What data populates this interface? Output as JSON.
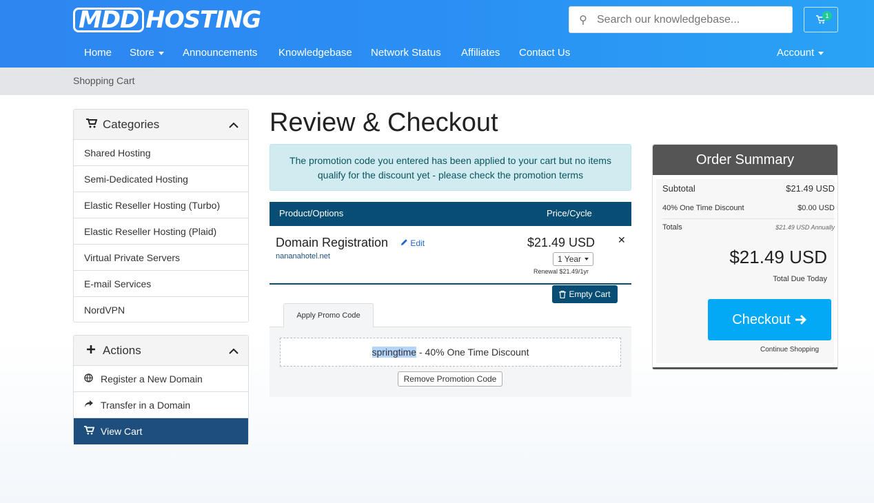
{
  "header": {
    "logo_a": "MDD",
    "logo_b": "HOSTING",
    "search_placeholder": "Search our knowledgebase...",
    "cart_count": "1",
    "cart_icon": "shopping-cart-icon"
  },
  "nav": {
    "home": "Home",
    "store": "Store",
    "announcements": "Announcements",
    "knowledgebase": "Knowledgebase",
    "network_status": "Network Status",
    "affiliates": "Affiliates",
    "contact": "Contact Us",
    "account": "Account"
  },
  "breadcrumb": "Shopping Cart",
  "sidebar": {
    "categories_title": "Categories",
    "categories": [
      "Shared Hosting",
      "Semi-Dedicated Hosting",
      "Elastic Reseller Hosting (Turbo)",
      "Elastic Reseller Hosting (Plaid)",
      "Virtual Private Servers",
      "E-mail Services",
      "NordVPN"
    ],
    "actions_title": "Actions",
    "actions": [
      {
        "label": "Register a New Domain",
        "icon": "globe-icon"
      },
      {
        "label": "Transfer in a Domain",
        "icon": "share-arrow-icon"
      },
      {
        "label": "View Cart",
        "icon": "shopping-cart-icon"
      }
    ]
  },
  "main": {
    "title": "Review & Checkout",
    "alert": "The promotion code you entered has been applied to your cart but no items qualify for the discount yet - please check the promotion terms",
    "table_header": {
      "product": "Product/Options",
      "price": "Price/Cycle"
    },
    "item": {
      "name": "Domain Registration",
      "edit": "Edit",
      "domain": "nananahotel.net",
      "price": "$21.49 USD",
      "cycle": "1 Year",
      "renewal": "Renewal $21.49/1yr"
    },
    "empty_cart": "Empty Cart",
    "promo_tab": "Apply Promo Code",
    "promo_code": "springtime",
    "promo_desc": " - 40% One Time Discount",
    "remove_promo": "Remove Promotion Code"
  },
  "summary": {
    "title": "Order Summary",
    "subtotal_label": "Subtotal",
    "subtotal_value": "$21.49 USD",
    "discount_label": "40% One Time Discount",
    "discount_value": "$0.00 USD",
    "totals_label": "Totals",
    "totals_value": "$21.49 USD Annually",
    "total_due": "$21.49 USD",
    "total_due_label": "Total Due Today",
    "checkout": "Checkout",
    "continue": "Continue Shopping"
  },
  "colors": {
    "header_blue": "#2a8ff3",
    "navy": "#084d73",
    "checkout_blue": "#03a9f4",
    "alert_bg": "#d1ecf1"
  }
}
